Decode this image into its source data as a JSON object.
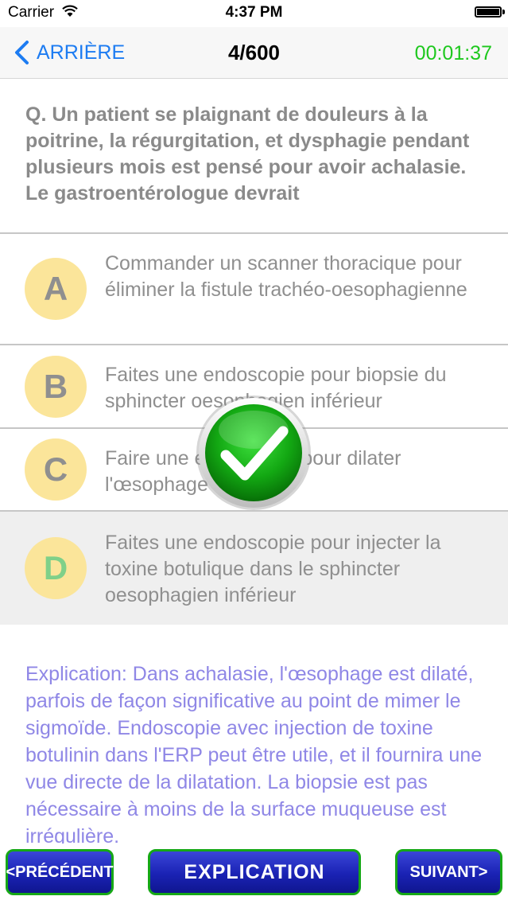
{
  "status_bar": {
    "carrier": "Carrier",
    "time": "4:37 PM"
  },
  "nav": {
    "back_label": "ARRIÈRE",
    "progress": "4/600",
    "timer": "00:01:37",
    "accent_color": "#1d7cf2",
    "timer_color": "#1ec81e"
  },
  "question": "Q. Un patient se plaignant de douleurs à la poitrine, la régurgitation, et dysphagie pendant plusieurs mois est pensé pour avoir achalasie. Le gastroentérologue devrait",
  "options": [
    {
      "letter": "A",
      "text": "Commander un scanner thoracique pour éliminer la fistule trachéo-oesophagienne"
    },
    {
      "letter": "B",
      "text": "Faites une endoscopie pour biopsie du sphincter oesophagien inférieur"
    },
    {
      "letter": "C",
      "text": "Faire une endoscopie pour dilater l'œsophage"
    },
    {
      "letter": "D",
      "text": "Faites une endoscopie pour injecter la toxine botulique dans le sphincter oesophagien inférieur"
    }
  ],
  "selected_option": "D",
  "correct_icon": "checkmark-icon",
  "explanation": "Explication: Dans achalasie, l'œsophage est dilaté, parfois de façon significative au point de mimer le sigmoïde. Endoscopie avec injection de toxine botulinin dans l'ERP peut être utile, et il fournira une vue directe de la dilatation. La biopsie est pas nécessaire à moins de la surface muqueuse est irrégulière.",
  "buttons": {
    "prev": "<PRÉCÉDENT",
    "explanation": "EXPLICATION",
    "next": "SUIVANT>"
  },
  "colors": {
    "option_circle": "#fbe59a",
    "explanation_text": "#8f87e6",
    "button_fill": "#1a22b4",
    "button_border": "#16a816"
  }
}
